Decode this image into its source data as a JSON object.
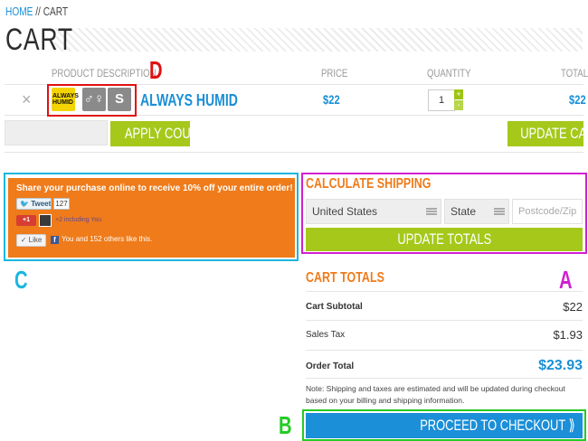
{
  "breadcrumb": {
    "home": "HOME",
    "separator": " // ",
    "current": "CART"
  },
  "page_title": "CART",
  "table": {
    "headers": {
      "product": "PRODUCT DESCRIPTION",
      "price": "PRICE",
      "quantity": "QUANTITY",
      "total": "TOTAL"
    },
    "row": {
      "remove": "×",
      "thumb_label": "ALWAYS HUMID",
      "thumb_icons": [
        "restroom-icon",
        "size-icon"
      ],
      "size_label": "S",
      "name": "ALWAYS HUMID",
      "price": "$22",
      "quantity": "1",
      "qty_plus": "+",
      "qty_minus": "-",
      "total": "$22"
    }
  },
  "coupon": {
    "value": "",
    "apply_label": "APPLY COUPON"
  },
  "update_cart_label": "UPDATE CART",
  "share": {
    "message": "Share your purchase online to receive 10% off your entire order!",
    "tweet_label": "Tweet",
    "tweet_count": "127",
    "gplus_label": "+1",
    "gplus_text": "+2 including You",
    "like_label": "Like",
    "fb_text": "You and 152 others like this."
  },
  "shipping": {
    "heading": "CALCULATE SHIPPING",
    "country": "United States",
    "state": "State",
    "postcode_placeholder": "Postcode/Zip",
    "update_label": "UPDATE TOTALS"
  },
  "totals": {
    "heading": "CART TOTALS",
    "subtotal_label": "Cart Subtotal",
    "subtotal_value": "$22",
    "tax_label": "Sales Tax",
    "tax_value": "$1.93",
    "order_label": "Order Total",
    "order_value": "$23.93",
    "note": "Note: Shipping and taxes are estimated and will be updated during checkout based on your billing and shipping information."
  },
  "checkout_label": "PROCEED TO CHECKOUT ⟫",
  "annotations": {
    "a": "A",
    "b": "B",
    "c": "C",
    "d": "D"
  },
  "colors": {
    "accent_blue": "#1a8fd6",
    "accent_green": "#a5c81b",
    "accent_orange": "#ef7b1a",
    "mark_a": "#d21fd2",
    "mark_b": "#22cc22",
    "mark_c": "#1bb6e0",
    "mark_d": "#e01010"
  }
}
